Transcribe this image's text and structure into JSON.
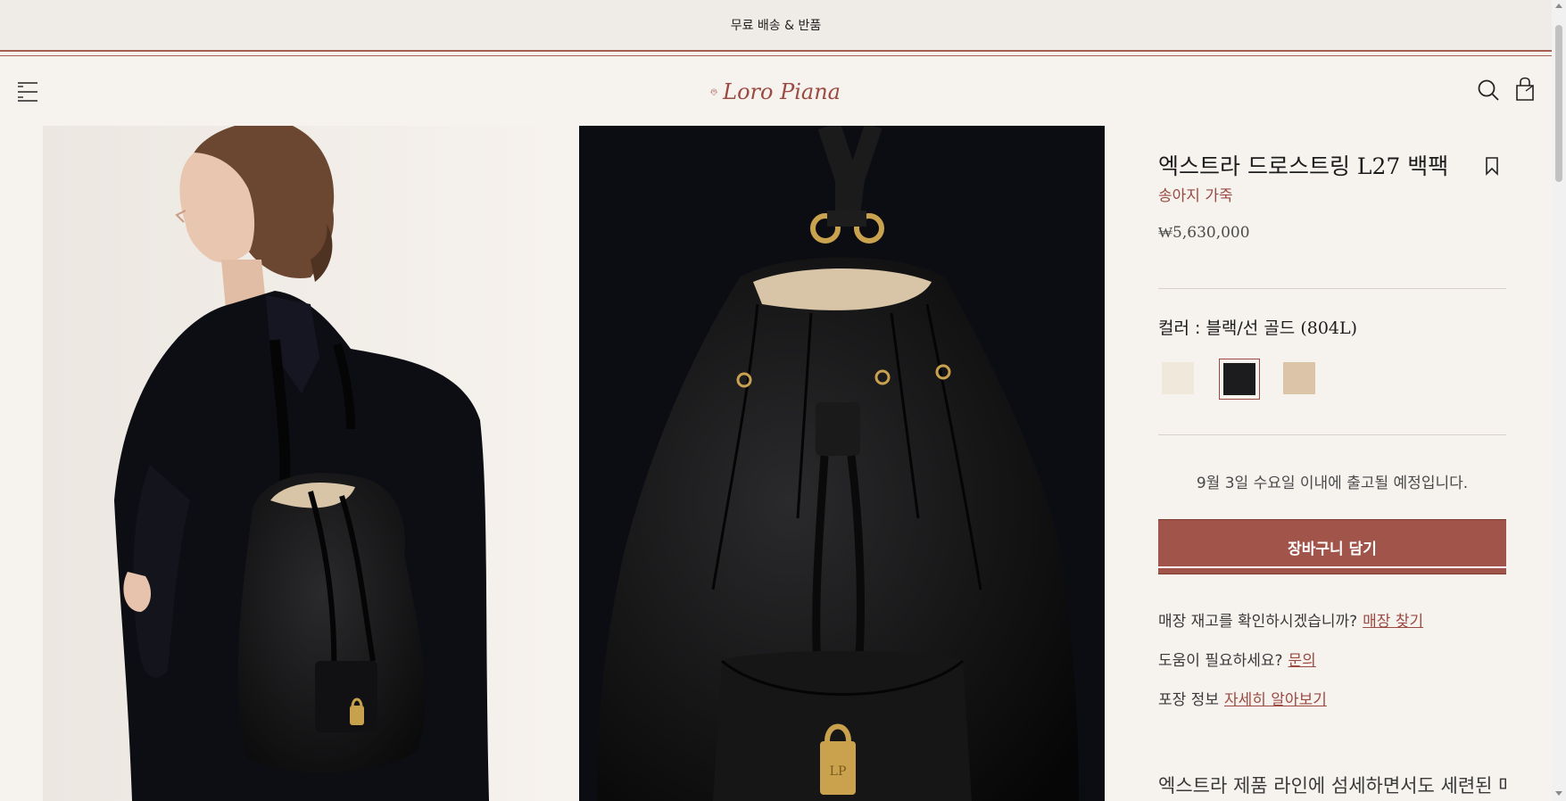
{
  "promo": {
    "text": "무료 배송 & 반품"
  },
  "header": {
    "logo_text": "Loro Piana",
    "menu_icon": "hamburger-menu-icon",
    "search_icon": "search-icon",
    "bag_icon": "shopping-bag-icon"
  },
  "gallery": {
    "images": [
      {
        "name": "model-wearing-backpack-photo"
      },
      {
        "name": "backpack-closeup-photo"
      }
    ]
  },
  "product": {
    "title": "엑스트라 드로스트링 L27 백팩",
    "material": "송아지 가죽",
    "price": "₩5,630,000",
    "color_label": "컬러 : 블랙/선 골드",
    "color_code": "(804L)",
    "swatches": [
      {
        "color": "#f0e8da",
        "selected": false
      },
      {
        "color": "#1c1c1e",
        "selected": true
      },
      {
        "color": "#dcc4a8",
        "selected": false
      }
    ],
    "shipping": "9월 3일 수요일 이내에 출고될 예정입니다.",
    "add_to_cart": "장바구니 담기",
    "store_stock_q": "매장 재고를 확인하시겠습니까?",
    "store_stock_link": "매장 찾기",
    "help_q": "도움이 필요하세요?",
    "help_link": "문의",
    "packaging_label": "포장 정보",
    "packaging_link": "자세히 알아보기",
    "description": "엑스트라 제품 라인에 섬세하면서도 세련된 매"
  },
  "colors": {
    "accent": "#9c4a41",
    "button": "#a0544a",
    "background": "#f6f3ef"
  }
}
